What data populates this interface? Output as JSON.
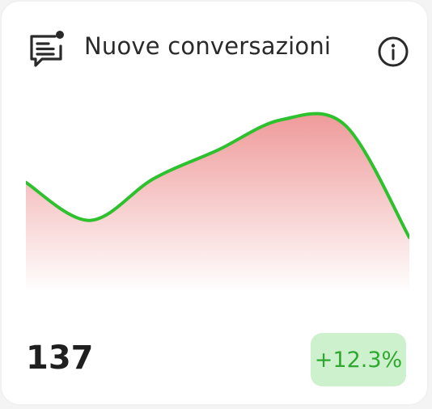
{
  "widget": {
    "title": "Nuove conversazioni",
    "icon": "chat-notification-icon",
    "info_icon": "info-icon",
    "value": "137",
    "change": "+12.3%",
    "colors": {
      "line": "#2ec12e",
      "area_top": "#ef9a9a",
      "badge_bg": "#cdf0cd",
      "badge_text": "#2fa82f"
    }
  },
  "chart_data": {
    "type": "area",
    "values": [
      58,
      38,
      60,
      75,
      91,
      88,
      29
    ],
    "ylim": [
      0,
      100
    ],
    "grid": false,
    "legend": "none"
  }
}
